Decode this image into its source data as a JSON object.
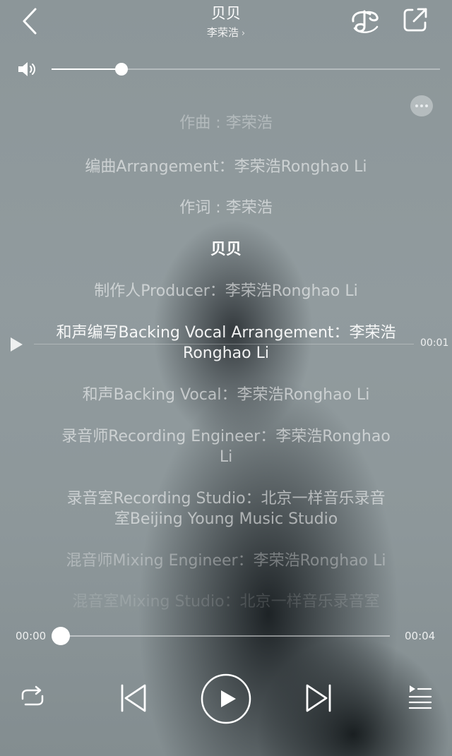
{
  "header": {
    "title": "贝贝",
    "artist": "李荣浩",
    "artist_chevron": "›"
  },
  "volume": {
    "level": 0.18
  },
  "lyrics": [
    {
      "text": "作曲 : 李荣浩",
      "state": "f1"
    },
    {
      "text": "编曲Arrangement：李荣浩Ronghao Li",
      "state": "normal"
    },
    {
      "text": "作词 : 李荣浩",
      "state": "normal"
    },
    {
      "text": "贝贝",
      "state": "current"
    },
    {
      "text": "制作人Producer：李荣浩Ronghao Li",
      "state": "normal"
    },
    {
      "text": "和声编写Backing Vocal Arrangement：李荣浩",
      "state": "active"
    },
    {
      "text": "Ronghao Li",
      "state": "active"
    },
    {
      "text": "和声Backing Vocal：李荣浩Ronghao Li",
      "state": "normal"
    },
    {
      "text": "录音师Recording Engineer：李荣浩Ronghao",
      "state": "normal"
    },
    {
      "text": "Li",
      "state": "normal"
    },
    {
      "text": "录音室Recording Studio：北京一样音乐录音",
      "state": "normal"
    },
    {
      "text": "室Beijing Young Music Studio",
      "state": "normal"
    },
    {
      "text": "混音师Mixing Engineer：李荣浩Ronghao Li",
      "state": "f1"
    },
    {
      "text": "混音室Mixing Studio：北京一样音乐录音室",
      "state": "f3"
    }
  ],
  "seek_line": {
    "time": "00:01"
  },
  "progress": {
    "current": "00:00",
    "total": "00:04",
    "fraction": 0.0
  },
  "icons": {
    "back": "chevron-left-icon",
    "hifi": "hifi-note-icon",
    "share": "share-icon",
    "volume": "volume-icon",
    "more": "more-icon",
    "repeat": "repeat-icon",
    "previous": "previous-icon",
    "play": "play-icon",
    "next": "next-icon",
    "playlist": "playlist-icon"
  }
}
